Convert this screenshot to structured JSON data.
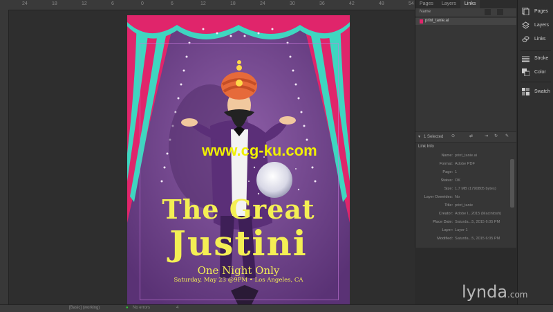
{
  "ruler": {
    "marks": [
      "24",
      "18",
      "12",
      "6",
      "0",
      "6",
      "12",
      "18",
      "24",
      "30",
      "36",
      "42",
      "48",
      "54"
    ]
  },
  "poster": {
    "title_line1": "The Great",
    "title_line2": "Justini",
    "subtitle": "One Night Only",
    "details": "Saturday, May 23 @9PM • Los Angeles, CA"
  },
  "links_panel": {
    "tabs": [
      "Pages",
      "Layers",
      "Links"
    ],
    "active_tab": "Links",
    "list_header": "Name",
    "items": [
      {
        "name": "print_tanie.ai"
      }
    ],
    "toolbar_text": "1 Selected",
    "link_info_title": "Link Info",
    "info": [
      {
        "k": "Name:",
        "v": "print_tanie.ai"
      },
      {
        "k": "Format:",
        "v": "Adobe PDF"
      },
      {
        "k": "Page:",
        "v": "1"
      },
      {
        "k": "Status:",
        "v": "OK"
      },
      {
        "k": "Size:",
        "v": "1.7 MB (1790805 bytes)"
      },
      {
        "k": "Layer Overrides:",
        "v": "No"
      },
      {
        "k": "Title:",
        "v": "print_tanie"
      },
      {
        "k": "Creator:",
        "v": "Adobe I...2015 (Macintosh)"
      },
      {
        "k": "Place Date:",
        "v": "Saturda...5, 2015 6:05 PM"
      },
      {
        "k": "Layer:",
        "v": "Layer 1"
      },
      {
        "k": "Modified:",
        "v": "Saturda...5, 2015 6:05 PM"
      }
    ]
  },
  "dock": {
    "items": [
      {
        "label": "Pages",
        "icon": "pages-icon"
      },
      {
        "label": "Layers",
        "icon": "layers-icon"
      },
      {
        "label": "Links",
        "icon": "links-icon"
      },
      {
        "label": "Stroke",
        "icon": "stroke-icon"
      },
      {
        "label": "Color",
        "icon": "color-icon"
      },
      {
        "label": "Swatch",
        "icon": "swatches-icon"
      }
    ]
  },
  "bottom_bar": {
    "zoom": "4",
    "status": "[Basic] (working)",
    "preflight": "No errors"
  },
  "watermarks": {
    "cg": "www.cg-ku.com",
    "lynda": "lynda",
    "lynda_suffix": ".com"
  },
  "colors": {
    "curtain_red": "#e0256b",
    "curtain_teal": "#3fd6c0",
    "poster_bg": "#6a3f86",
    "title_yellow": "#f4ef54"
  }
}
